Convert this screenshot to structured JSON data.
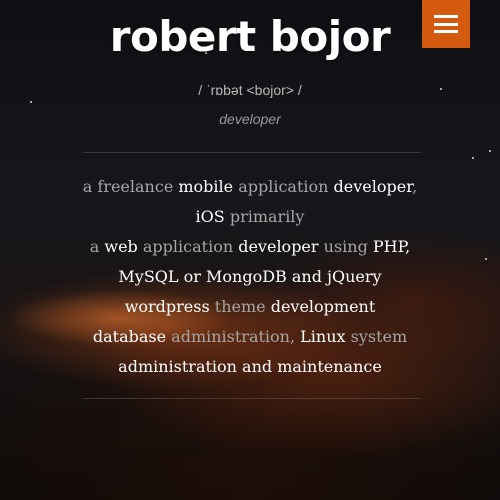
{
  "header": {
    "site_title": "robert bojor",
    "menu_icon": "hamburger-menu-icon",
    "menu_button_color": "#d35a0f"
  },
  "intro": {
    "phonetic": "/ ˈrɒbət <bojor> /",
    "role": "developer"
  },
  "bio": {
    "lines": [
      [
        {
          "text": "a freelance ",
          "emph": false
        },
        {
          "text": "mobile",
          "emph": true
        },
        {
          "text": " application ",
          "emph": false
        },
        {
          "text": "developer",
          "emph": true
        },
        {
          "text": ",",
          "emph": false
        }
      ],
      [
        {
          "text": "iOS",
          "emph": true
        },
        {
          "text": " primarily",
          "emph": false
        }
      ],
      [
        {
          "text": "a ",
          "emph": false
        },
        {
          "text": "web",
          "emph": true
        },
        {
          "text": " application ",
          "emph": false
        },
        {
          "text": "developer",
          "emph": true
        },
        {
          "text": " using ",
          "emph": false
        },
        {
          "text": "PHP,",
          "emph": true
        }
      ],
      [
        {
          "text": "MySQL or MongoDB and jQuery",
          "emph": true
        }
      ],
      [
        {
          "text": "wordpress",
          "emph": true
        },
        {
          "text": " theme ",
          "emph": false
        },
        {
          "text": "development",
          "emph": true
        }
      ],
      [
        {
          "text": "database",
          "emph": true
        },
        {
          "text": " administration, ",
          "emph": false
        },
        {
          "text": "Linux",
          "emph": true
        },
        {
          "text": " system",
          "emph": false
        }
      ],
      [
        {
          "text": "administration and maintenance",
          "emph": true
        }
      ]
    ]
  }
}
